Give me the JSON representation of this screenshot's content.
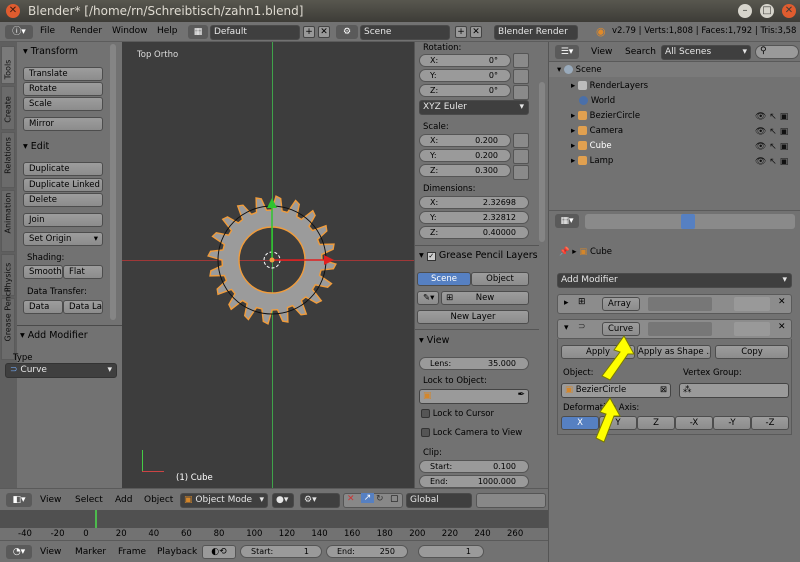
{
  "window": {
    "title": "Blender* [/home/rn/Schreibtisch/zahn1.blend]"
  },
  "topbar": {
    "menus": [
      "File",
      "Render",
      "Window",
      "Help"
    ],
    "layout": "Default",
    "scene": "Scene",
    "engine": "Blender Render",
    "stats": "v2.79 | Verts:1,808 | Faces:1,792 | Tris:3,58"
  },
  "tool_tabs": [
    "Tools",
    "Create",
    "Relations",
    "Animation",
    "Physics",
    "Grease Pencil"
  ],
  "tools": {
    "transform_header": "Transform",
    "translate": "Translate",
    "rotate": "Rotate",
    "scale": "Scale",
    "mirror": "Mirror",
    "edit_header": "Edit",
    "duplicate": "Duplicate",
    "duplicate_linked": "Duplicate Linked",
    "delete": "Delete",
    "join": "Join",
    "set_origin": "Set Origin",
    "shading_label": "Shading:",
    "smooth": "Smooth",
    "flat": "Flat",
    "data_transfer_label": "Data Transfer:",
    "data": "Data",
    "data_la": "Data La"
  },
  "operator": {
    "header": "Add Modifier",
    "type_label": "Type",
    "type_value": "Curve"
  },
  "viewport": {
    "view_name": "Top Ortho",
    "object_label": "(1) Cube"
  },
  "nprops": {
    "rotation_label": "Rotation:",
    "rotation": {
      "x": "0°",
      "y": "0°",
      "z": "0°"
    },
    "euler": "XYZ Euler",
    "scale_label": "Scale:",
    "scale": {
      "x": "0.200",
      "y": "0.200",
      "z": "0.300"
    },
    "dimensions_label": "Dimensions:",
    "dimensions": {
      "x": "2.32698",
      "y": "2.32812",
      "z": "0.40000"
    },
    "gp_header": "Grease Pencil Layers",
    "gp_scene": "Scene",
    "gp_object": "Object",
    "gp_new": "New",
    "gp_new_layer": "New Layer",
    "view_header": "View",
    "lens_label": "Lens:",
    "lens_value": "35.000",
    "lock_object_label": "Lock to Object:",
    "lock_cursor": "Lock to Cursor",
    "lock_camera": "Lock Camera to View",
    "clip_label": "Clip:",
    "clip_start_label": "Start:",
    "clip_start": "0.100",
    "clip_end_label": "End:",
    "clip_end": "1000.000"
  },
  "view3d_header": {
    "menus": [
      "View",
      "Select",
      "Add",
      "Object"
    ],
    "mode": "Object Mode",
    "orientation": "Global"
  },
  "timeline": {
    "ticks": [
      "-40",
      "-20",
      "0",
      "20",
      "40",
      "60",
      "80",
      "100",
      "120",
      "140",
      "160",
      "180",
      "200",
      "220",
      "240",
      "260"
    ],
    "menus": [
      "View",
      "Marker",
      "Frame",
      "Playback"
    ],
    "start_label": "Start:",
    "start": "1",
    "end_label": "End:",
    "end": "250",
    "current": "1"
  },
  "outliner": {
    "view": "View",
    "search": "Search",
    "scenes": "All Scenes",
    "items": [
      "Scene",
      "RenderLayers",
      "World",
      "BezierCircle",
      "Camera",
      "Cube",
      "Lamp"
    ]
  },
  "properties": {
    "breadcrumb": "Cube",
    "add_modifier": "Add Modifier",
    "array_name": "Array",
    "curve_name": "Curve",
    "apply": "Apply",
    "apply_shape": "Apply as Shape ...",
    "copy": "Copy",
    "object_label": "Object:",
    "vertex_group_label": "Vertex Group:",
    "object_value": "BezierCircle",
    "deform_axis_label": "Deformation Axis:",
    "axes": [
      "X",
      "Y",
      "Z",
      "-X",
      "-Y",
      "-Z"
    ]
  },
  "colors": {
    "accent": "#5680c2",
    "viewport": "#3d3d3d",
    "panel": "#727272",
    "gear": "#9b9b9b",
    "selection": "#f09c3c",
    "annotation": "#ffff00"
  }
}
